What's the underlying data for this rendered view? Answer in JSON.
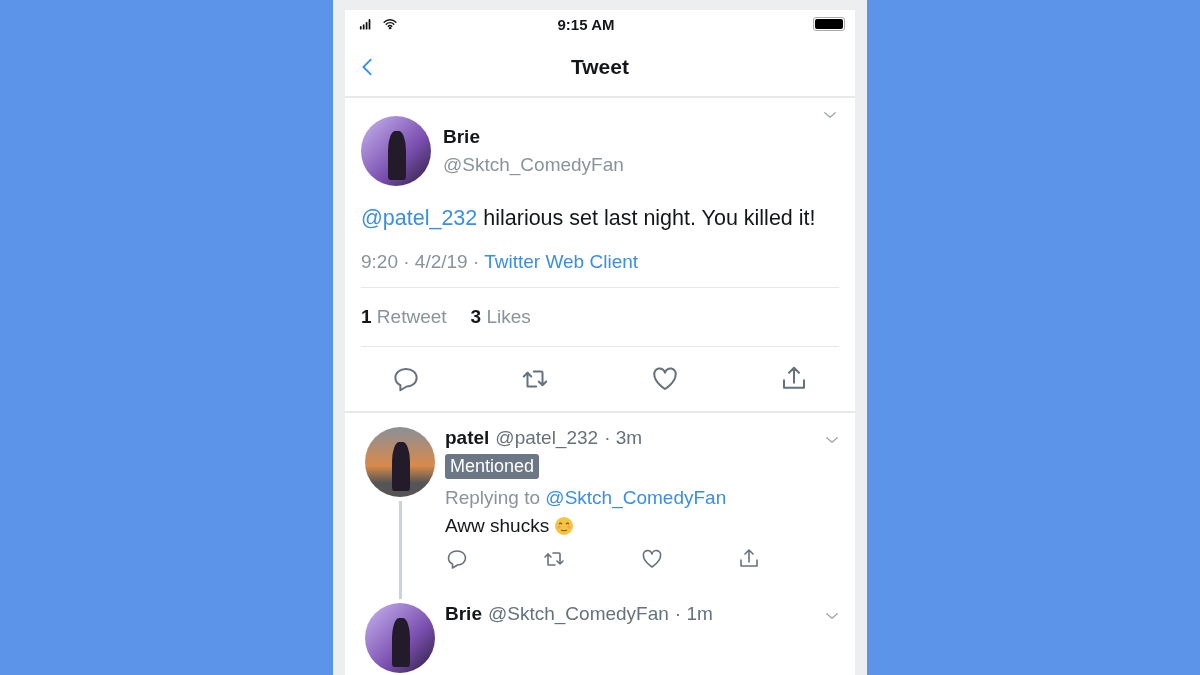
{
  "status_bar": {
    "time": "9:15 AM"
  },
  "nav": {
    "title": "Tweet"
  },
  "tweet": {
    "name": "Brie",
    "handle": "@Sktch_ComedyFan",
    "mention": "@patel_232",
    "body": " hilarious set last night. You killed it!",
    "time": "9:20 · 4/2/19 · ",
    "source": "Twitter Web Client",
    "stats": [
      {
        "count": "1",
        "label": "Retweet"
      },
      {
        "count": "3",
        "label": "Likes"
      }
    ]
  },
  "replies": [
    {
      "name": "patel",
      "handle": "@patel_232",
      "age": "· 3m",
      "badge": "Mentioned",
      "replying_label": "Replying to",
      "replying_to": "@Sktch_ComedyFan",
      "text": "Aww shucks",
      "emoji": true,
      "thread": true
    },
    {
      "name": "Brie",
      "handle": "@Sktch_ComedyFan",
      "age": "· 1m",
      "emoji": false,
      "thread": false
    }
  ]
}
